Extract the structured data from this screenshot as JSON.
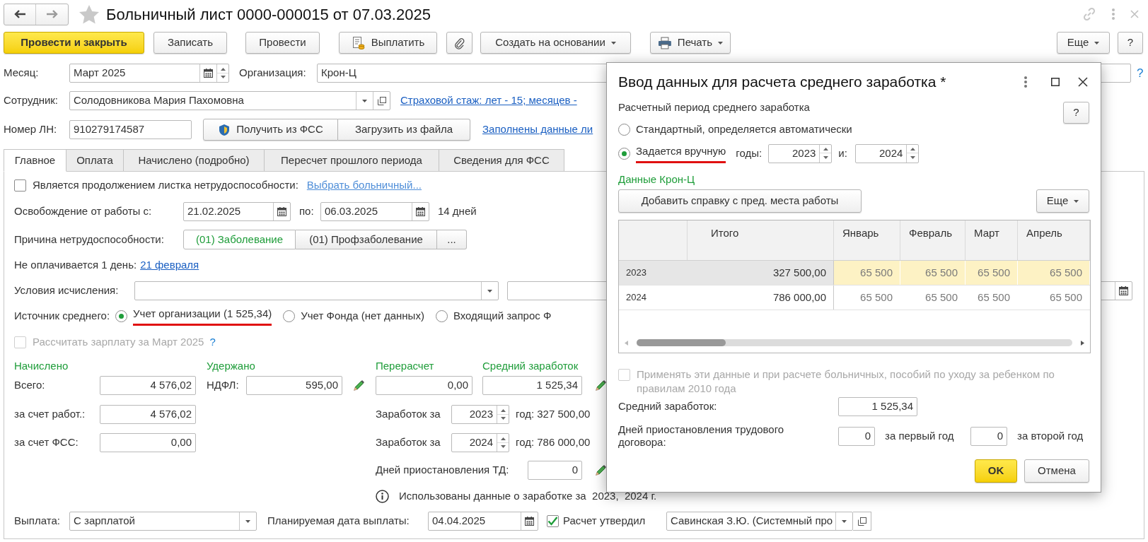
{
  "title_bar": {
    "title": "Больничный лист 0000-000015 от 07.03.2025"
  },
  "toolbar": {
    "buttons": [
      {
        "label": "Провести и закрыть",
        "kind": "primary"
      },
      {
        "label": "Записать",
        "kind": "plain"
      },
      {
        "label": "Провести",
        "kind": "plain"
      },
      {
        "label": "Выплатить",
        "kind": "pay"
      },
      {
        "kind": "attach"
      },
      {
        "label": "Создать на основании",
        "kind": "dropdown"
      },
      {
        "label": "Печать",
        "kind": "print"
      }
    ],
    "right_buttons": [
      {
        "label": "Еще",
        "kind": "dropdown"
      },
      {
        "label": "?",
        "kind": "plain"
      }
    ]
  },
  "header": {
    "month": {
      "label": "Месяц:",
      "value": "Март 2025"
    },
    "organization": {
      "label": "Организация:",
      "value": "Крон-Ц",
      "help": "?"
    },
    "employee": {
      "label": "Сотрудник:",
      "value": "Солодовникова Мария Пахомовна",
      "link": "Страховой стаж: лет - 15; месяцев -"
    },
    "sick_number": {
      "label": "Номер ЛН:",
      "value": "910279174587",
      "buttons": [
        "Получить из ФСС",
        "Загрузить из файла"
      ],
      "link": "Заполнены данные ли"
    }
  },
  "tabs": [
    {
      "label": "Главное",
      "selected": true
    },
    {
      "label": "Оплата",
      "selected": false
    },
    {
      "label": "Начислено (подробно)",
      "selected": false
    },
    {
      "label": "Пересчет прошлого периода",
      "selected": false
    },
    {
      "label": "Сведения для ФСС",
      "selected": false
    }
  ],
  "main": {
    "continuation": {
      "label": "Является продолжением листка нетрудоспособности:",
      "checked": false,
      "link": "Выбрать больничный..."
    },
    "release": {
      "label": "Освобождение от работы с:",
      "from": "21.02.2025",
      "to_label": "по:",
      "to": "06.03.2025",
      "days": "14 дней"
    },
    "reason": {
      "label": "Причина нетрудоспособности:",
      "options": [
        {
          "label": "(01) Заболевание",
          "selected": true
        },
        {
          "label": "(01) Профзаболевание",
          "selected": false
        }
      ],
      "more": "..."
    },
    "unpaid": {
      "label": "Не оплачивается 1 день:",
      "link": "21 февраля"
    },
    "conditions": {
      "label": "Условия исчисления:"
    },
    "avg_source": {
      "label": "Источник среднего:",
      "options": [
        {
          "label": "Учет организации (1 525,34)",
          "selected": true,
          "underlined": true
        },
        {
          "label": "Учет Фонда (нет данных)",
          "selected": false,
          "underlined": false
        },
        {
          "label": "Входящий запрос Ф",
          "selected": false,
          "underlined": false
        }
      ]
    },
    "recalc_salary": {
      "label": "Рассчитать зарплату за Март 2025",
      "checked": false,
      "disabled": true,
      "help": "?"
    },
    "accrued": {
      "title": "Начислено",
      "rows": [
        {
          "label": "Всего:",
          "value": "4 576,02"
        },
        {
          "label": "за счет работ.:",
          "value": "4 576,02"
        },
        {
          "label": "за счет ФСС:",
          "value": "0,00"
        }
      ]
    },
    "withheld": {
      "title": "Удержано",
      "label": "НДФЛ:",
      "value": "595,00"
    },
    "recalculation": {
      "title": "Перерасчет",
      "value": "0,00"
    },
    "average": {
      "title": "Средний заработок",
      "value": "1 525,34",
      "years": [
        {
          "label": "Заработок за",
          "year": "2023",
          "suffix": "год: 327 500,00"
        },
        {
          "label": "Заработок за",
          "year": "2024",
          "suffix": "год: 786 000,00"
        }
      ],
      "suspension": {
        "label": "Дней приостановления ТД:",
        "value": "0"
      }
    },
    "info": "Использованы данные о заработке за  2023,  2024 г.",
    "payment": {
      "label": "Выплата:",
      "value": "С зарплатой",
      "date_label": "Планируемая дата выплаты:",
      "date": "04.04.2025",
      "approved_label": "Расчет утвердил",
      "approved": true,
      "approver": "Савинская З.Ю. (Системный про"
    }
  },
  "dialog": {
    "title": "Ввод данных для расчета среднего заработка *",
    "period_label": "Расчетный период среднего заработка",
    "help": "?",
    "modes": [
      {
        "label": "Стандартный, определяется автоматически",
        "selected": false,
        "underlined": false
      },
      {
        "label": "Задается вручную",
        "selected": true,
        "underlined": true
      }
    ],
    "years_label": "годы:",
    "year1": "2023",
    "and_label": "и:",
    "year2": "2024",
    "section": "Данные Крон-Ц",
    "add_button": "Добавить справку с пред. места работы",
    "more_button": "Еще",
    "table": {
      "columns": [
        "Итого",
        "Январь",
        "Февраль",
        "Март",
        "Апрель"
      ],
      "rows": [
        {
          "year": "2023",
          "total": "327 500,00",
          "months": [
            "65 500",
            "65 500",
            "65 500",
            "65 500"
          ],
          "selected": true
        },
        {
          "year": "2024",
          "total": "786 000,00",
          "months": [
            "65 500",
            "65 500",
            "65 500",
            "65 500"
          ],
          "selected": false
        }
      ]
    },
    "apply": {
      "label": "Применять эти данные и при расчете больничных, пособий по уходу за ребенком по правилам 2010 года",
      "checked": false,
      "disabled": true
    },
    "average": {
      "label": "Средний заработок:",
      "value": "1 525,34"
    },
    "suspension": {
      "label": "Дней приостановления трудового договора:",
      "first": "0",
      "first_label": "за первый год",
      "second": "0",
      "second_label": "за второй год"
    },
    "buttons": [
      {
        "label": "OK",
        "kind": "primary"
      },
      {
        "label": "Отмена",
        "kind": "plain"
      }
    ]
  }
}
